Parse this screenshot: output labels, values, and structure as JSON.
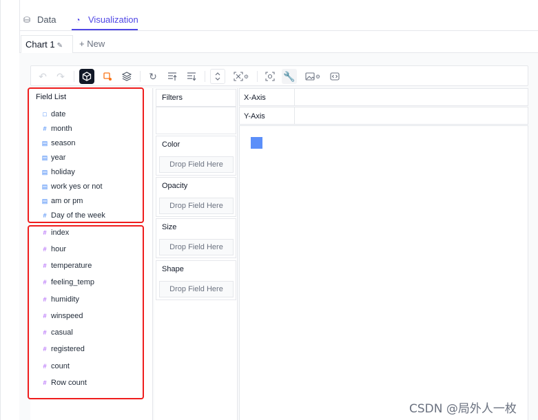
{
  "top_tabs": [
    {
      "label": "Data",
      "icon": "database-icon"
    },
    {
      "label": "Visualization",
      "icon": "chart-pie-icon"
    }
  ],
  "chart_tabs": {
    "active_label": "Chart 1",
    "edit_icon": "edit-icon",
    "new_label": "+ New"
  },
  "toolbar": {
    "buttons": [
      "undo-icon",
      "redo-icon",
      "cube-icon",
      "paint-icon",
      "layers-icon",
      "refresh-icon",
      "sort-asc-icon",
      "sort-desc-icon",
      "expand-icon",
      "fullscreen-icon",
      "settings-icon",
      "zoom-icon",
      "wrench-icon",
      "image-icon",
      "code-icon"
    ]
  },
  "field_list": {
    "title": "Field List",
    "dimensions": [
      {
        "label": "date",
        "icon": "calendar-icon"
      },
      {
        "label": "month",
        "icon": "hash-icon"
      },
      {
        "label": "season",
        "icon": "text-icon"
      },
      {
        "label": "year",
        "icon": "text-icon"
      },
      {
        "label": "holiday",
        "icon": "text-icon"
      },
      {
        "label": "work yes or not",
        "icon": "text-icon"
      },
      {
        "label": "am or pm",
        "icon": "text-icon"
      },
      {
        "label": "Day of the week",
        "icon": "hash-icon"
      }
    ],
    "measures": [
      {
        "label": "index",
        "icon": "hash-icon"
      },
      {
        "label": "hour",
        "icon": "hash-icon"
      },
      {
        "label": "temperature",
        "icon": "hash-icon"
      },
      {
        "label": "feeling_temp",
        "icon": "hash-icon"
      },
      {
        "label": "humidity",
        "icon": "hash-icon"
      },
      {
        "label": "winspeed",
        "icon": "hash-icon"
      },
      {
        "label": "casual",
        "icon": "hash-icon"
      },
      {
        "label": "registered",
        "icon": "hash-icon"
      },
      {
        "label": "count",
        "icon": "hash-icon"
      },
      {
        "label": "Row count",
        "icon": "hash-icon"
      }
    ]
  },
  "encodings": {
    "filters_label": "Filters",
    "color_label": "Color",
    "opacity_label": "Opacity",
    "size_label": "Size",
    "shape_label": "Shape",
    "drop_placeholder": "Drop Field Here"
  },
  "axes": {
    "x_label": "X-Axis",
    "y_label": "Y-Axis"
  },
  "colors": {
    "accent": "#4f46e5",
    "mark": "#5b8ff9",
    "highlight_box": "#ef1c1c"
  },
  "watermark": "CSDN @局外人一枚"
}
